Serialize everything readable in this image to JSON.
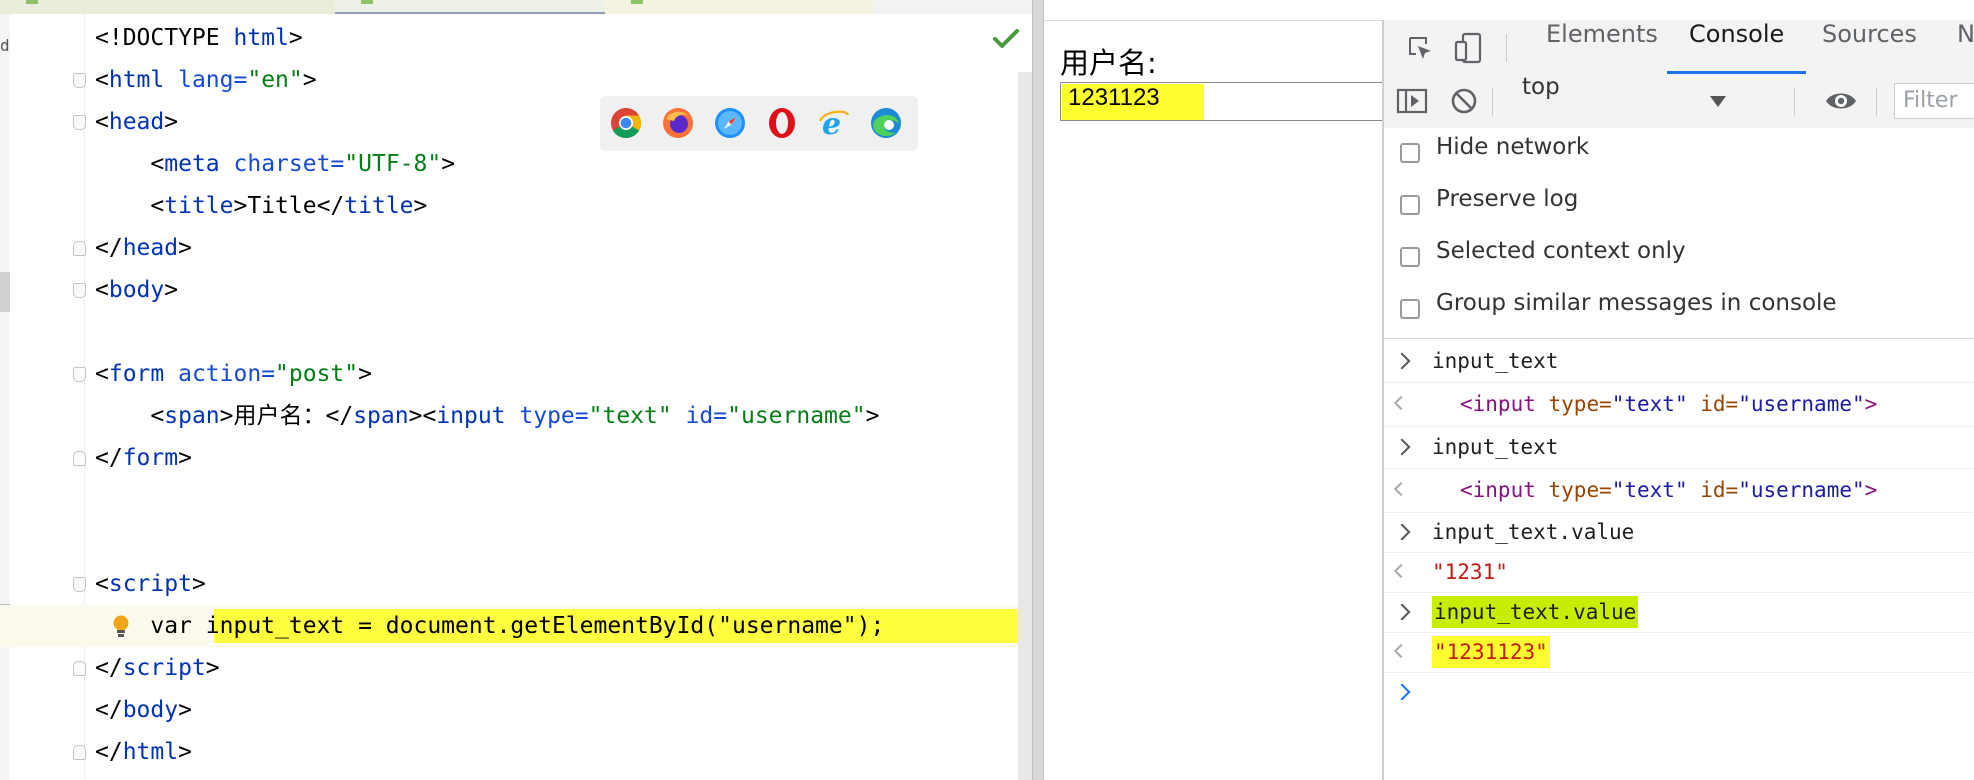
{
  "editor": {
    "lines": [
      {
        "parts": [
          [
            "txt",
            "<!DOCTYPE "
          ],
          [
            "tag",
            "html"
          ],
          [
            "txt",
            ">"
          ]
        ]
      },
      {
        "parts": [
          [
            "txt",
            "<"
          ],
          [
            "tag",
            "html "
          ],
          [
            "attr",
            "lang="
          ],
          [
            "val",
            "\"en\""
          ],
          [
            "txt",
            ">"
          ]
        ]
      },
      {
        "parts": [
          [
            "txt",
            "<"
          ],
          [
            "tag",
            "head"
          ],
          [
            "txt",
            ">"
          ]
        ]
      },
      {
        "parts": [
          [
            "txt",
            "    <"
          ],
          [
            "tag",
            "meta "
          ],
          [
            "attr",
            "charset="
          ],
          [
            "val",
            "\"UTF-8\""
          ],
          [
            "txt",
            ">"
          ]
        ]
      },
      {
        "parts": [
          [
            "txt",
            "    <"
          ],
          [
            "tag",
            "title"
          ],
          [
            "txt",
            ">Title</"
          ],
          [
            "tag",
            "title"
          ],
          [
            "txt",
            ">"
          ]
        ]
      },
      {
        "parts": [
          [
            "txt",
            "</"
          ],
          [
            "tag",
            "head"
          ],
          [
            "txt",
            ">"
          ]
        ]
      },
      {
        "parts": [
          [
            "txt",
            "<"
          ],
          [
            "tag",
            "body"
          ],
          [
            "txt",
            ">"
          ]
        ]
      },
      {
        "parts": []
      },
      {
        "parts": [
          [
            "txt",
            "<"
          ],
          [
            "tag",
            "form "
          ],
          [
            "attr",
            "action="
          ],
          [
            "val",
            "\"post\""
          ],
          [
            "txt",
            ">"
          ]
        ]
      },
      {
        "parts": [
          [
            "txt",
            "    <"
          ],
          [
            "tag",
            "span"
          ],
          [
            "txt",
            ">用户名：</"
          ],
          [
            "tag",
            "span"
          ],
          [
            "txt",
            ">"
          ],
          [
            "txt",
            "<"
          ],
          [
            "tag",
            "input "
          ],
          [
            "attr",
            "type="
          ],
          [
            "val",
            "\"text\" "
          ],
          [
            "attr",
            "id="
          ],
          [
            "val",
            "\"username\""
          ],
          [
            "txt",
            ">"
          ]
        ]
      },
      {
        "parts": [
          [
            "txt",
            "</"
          ],
          [
            "tag",
            "form"
          ],
          [
            "txt",
            ">"
          ]
        ]
      },
      {
        "parts": []
      },
      {
        "parts": []
      },
      {
        "parts": [
          [
            "txt",
            "<"
          ],
          [
            "tag",
            "script"
          ],
          [
            "txt",
            ">"
          ]
        ]
      },
      {
        "parts": [
          [
            "txt",
            "    var "
          ],
          [
            "hl",
            "input_text = document.getElementById(\"username\");"
          ]
        ]
      },
      {
        "parts": [
          [
            "txt",
            "</"
          ],
          [
            "tag",
            "script"
          ],
          [
            "txt",
            ">"
          ]
        ]
      },
      {
        "parts": [
          [
            "txt",
            "</"
          ],
          [
            "tag",
            "body"
          ],
          [
            "txt",
            ">"
          ]
        ]
      },
      {
        "parts": [
          [
            "txt",
            "</"
          ],
          [
            "tag",
            "html"
          ],
          [
            "txt",
            ">"
          ]
        ]
      }
    ],
    "fold_markers": {
      "1": "down",
      "2": "down",
      "5": "up",
      "6": "down",
      "8": "down",
      "10": "up",
      "13": "down",
      "15": "up",
      "17": "up"
    },
    "caret_line": 14,
    "icons": [
      "check-icon",
      "intention-bulb-icon"
    ],
    "browser_icons": [
      "chrome-icon",
      "firefox-icon",
      "safari-icon",
      "opera-icon",
      "ie-icon",
      "edge-icon"
    ],
    "accent_colors": {
      "tag": "#0033b3",
      "attr": "#174ad4",
      "value": "#067d17",
      "highlight": "#ffff40"
    }
  },
  "page": {
    "label": "用户名:",
    "input_value": "1231123"
  },
  "devtools": {
    "tabs": [
      "Elements",
      "Console",
      "Sources",
      "Ne"
    ],
    "active_tab": "Console",
    "context": "top",
    "filter_placeholder": "Filter",
    "settings": [
      "Hide network",
      "Preserve log",
      "Selected context only",
      "Group similar messages in console"
    ],
    "messages": [
      {
        "type": "input",
        "text": "input_text"
      },
      {
        "type": "element",
        "parts": [
          [
            "tag",
            "<input "
          ],
          [
            "attr",
            "type="
          ],
          [
            "val",
            "\"text\" "
          ],
          [
            "attr",
            "id="
          ],
          [
            "val",
            "\"username\""
          ],
          [
            "tag",
            ">"
          ]
        ]
      },
      {
        "type": "input",
        "text": "input_text"
      },
      {
        "type": "element",
        "parts": [
          [
            "tag",
            "<input "
          ],
          [
            "attr",
            "type="
          ],
          [
            "val",
            "\"text\" "
          ],
          [
            "attr",
            "id="
          ],
          [
            "val",
            "\"username\""
          ],
          [
            "tag",
            ">"
          ]
        ]
      },
      {
        "type": "input",
        "text": "input_text.value"
      },
      {
        "type": "string",
        "text": "\"1231\""
      },
      {
        "type": "input",
        "text": "input_text.value",
        "highlight": "#c5ee00"
      },
      {
        "type": "string",
        "text": "\"1231123\"",
        "highlight": "#ffff30"
      }
    ]
  }
}
